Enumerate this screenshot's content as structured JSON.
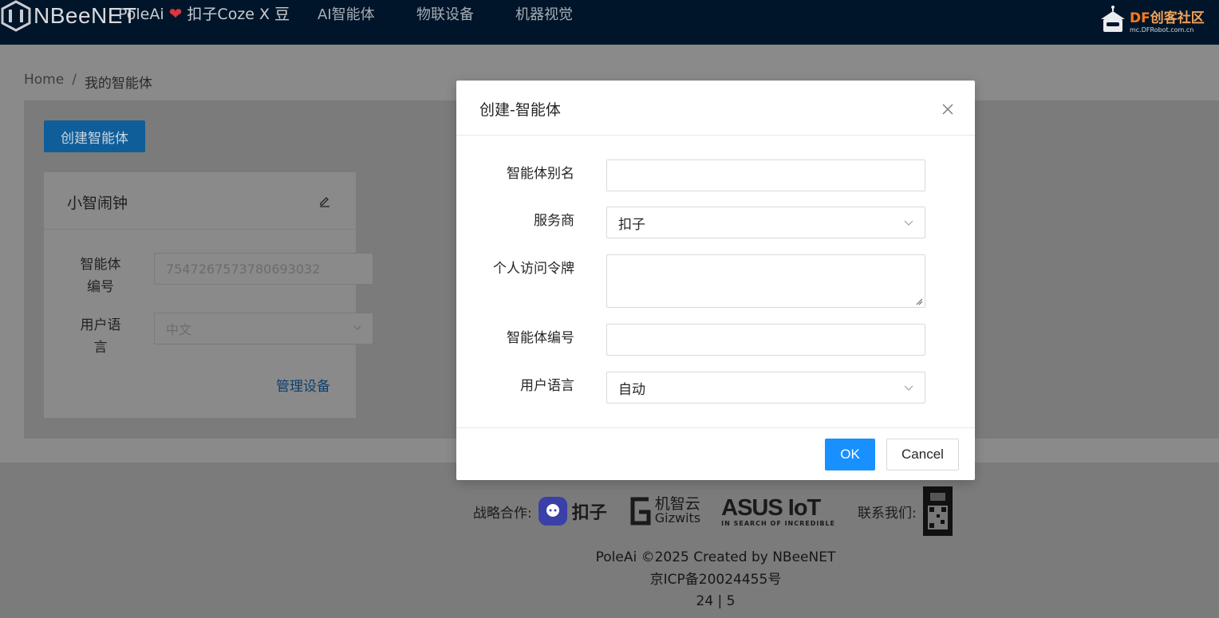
{
  "nav": {
    "logo_text": "NBeeNET",
    "brand_left": "PoleAi",
    "brand_heart": "❤",
    "brand_right": "扣子Coze X 豆",
    "items": [
      {
        "label": "AI智能体"
      },
      {
        "label": "物联设备"
      },
      {
        "label": "机器视觉"
      }
    ],
    "df_logo": {
      "title_prefix": "DF",
      "title_rest": "创客社区",
      "url": "mc.DFRobot.com.cn"
    }
  },
  "breadcrumb": {
    "home": "Home",
    "separator": "/",
    "current": "我的智能体"
  },
  "toolbar": {
    "create_label": "创建智能体"
  },
  "agent_card": {
    "title": "小智闹钟",
    "id_label_line1": "智能体",
    "id_label_line2": "编号",
    "id_value": "7547267573780693032",
    "lang_label_line1": "用户语",
    "lang_label_line2": "言",
    "lang_value": "中文",
    "manage_label": "管理设备"
  },
  "footer": {
    "partners_label": "战略合作:",
    "coze_label": "扣子",
    "gizwits_cn": "机智云",
    "gizwits_en": "Gizwits",
    "asus_main": "ASUS IoT",
    "asus_sub": "IN SEARCH OF INCREDIBLE",
    "contact_label": "联系我们:",
    "copyright": "PoleAi ©2025 Created by NBeeNET",
    "icp": "京ICP备20024455号",
    "counter": "24 | 5"
  },
  "modal": {
    "title": "创建-智能体",
    "fields": {
      "alias_label": "智能体别名",
      "alias_value": "",
      "provider_label": "服务商",
      "provider_value": "扣子",
      "token_label": "个人访问令牌",
      "token_value": "",
      "agent_id_label": "智能体编号",
      "agent_id_value": "",
      "language_label": "用户语言",
      "language_value": "自动"
    },
    "ok_label": "OK",
    "cancel_label": "Cancel"
  },
  "colors": {
    "topbar": "#001529",
    "primary": "#1890ff",
    "overlay_bg": "#8a8a8a"
  }
}
